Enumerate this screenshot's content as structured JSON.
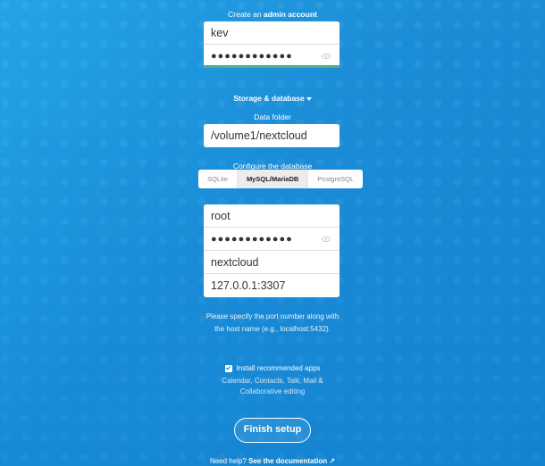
{
  "admin": {
    "title_prefix": "Create an ",
    "title_bold": "admin account",
    "username": "kev",
    "password_dots": "●●●●●●●●●●●●"
  },
  "storage_toggle": "Storage & database",
  "data_folder": {
    "label": "Data folder",
    "value": "/volume1/nextcloud"
  },
  "database": {
    "label": "Configure the database",
    "tabs": [
      "SQLite",
      "MySQL/MariaDB",
      "PostgreSQL"
    ],
    "active_tab": "MySQL/MariaDB",
    "user": "root",
    "password_dots": "●●●●●●●●●●●●",
    "name": "nextcloud",
    "host": "127.0.0.1:3307",
    "hint_line1": "Please specify the port number along with",
    "hint_line2": "the host name (e.g., localhost:5432)."
  },
  "recommended": {
    "label": "Install recommended apps",
    "checked": true,
    "desc_line1": "Calendar, Contacts, Talk, Mail &",
    "desc_line2": "Collaborative editing"
  },
  "finish_label": "Finish setup",
  "help": {
    "prefix": "Need help? ",
    "link": "See the documentation ↗"
  },
  "colors": {
    "background": "#1288d6",
    "strength_bar": "#49b382"
  }
}
